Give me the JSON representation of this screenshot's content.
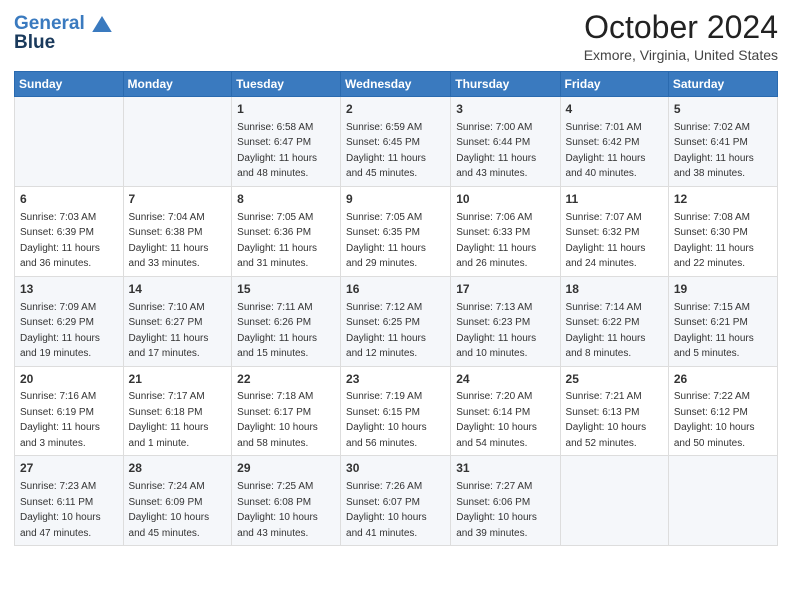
{
  "header": {
    "logo_line1": "General",
    "logo_line2": "Blue",
    "month_title": "October 2024",
    "location": "Exmore, Virginia, United States"
  },
  "days_of_week": [
    "Sunday",
    "Monday",
    "Tuesday",
    "Wednesday",
    "Thursday",
    "Friday",
    "Saturday"
  ],
  "weeks": [
    [
      null,
      null,
      {
        "day": "1",
        "sunrise": "6:58 AM",
        "sunset": "6:47 PM",
        "daylight": "11 hours and 48 minutes."
      },
      {
        "day": "2",
        "sunrise": "6:59 AM",
        "sunset": "6:45 PM",
        "daylight": "11 hours and 45 minutes."
      },
      {
        "day": "3",
        "sunrise": "7:00 AM",
        "sunset": "6:44 PM",
        "daylight": "11 hours and 43 minutes."
      },
      {
        "day": "4",
        "sunrise": "7:01 AM",
        "sunset": "6:42 PM",
        "daylight": "11 hours and 40 minutes."
      },
      {
        "day": "5",
        "sunrise": "7:02 AM",
        "sunset": "6:41 PM",
        "daylight": "11 hours and 38 minutes."
      }
    ],
    [
      {
        "day": "6",
        "sunrise": "7:03 AM",
        "sunset": "6:39 PM",
        "daylight": "11 hours and 36 minutes."
      },
      {
        "day": "7",
        "sunrise": "7:04 AM",
        "sunset": "6:38 PM",
        "daylight": "11 hours and 33 minutes."
      },
      {
        "day": "8",
        "sunrise": "7:05 AM",
        "sunset": "6:36 PM",
        "daylight": "11 hours and 31 minutes."
      },
      {
        "day": "9",
        "sunrise": "7:05 AM",
        "sunset": "6:35 PM",
        "daylight": "11 hours and 29 minutes."
      },
      {
        "day": "10",
        "sunrise": "7:06 AM",
        "sunset": "6:33 PM",
        "daylight": "11 hours and 26 minutes."
      },
      {
        "day": "11",
        "sunrise": "7:07 AM",
        "sunset": "6:32 PM",
        "daylight": "11 hours and 24 minutes."
      },
      {
        "day": "12",
        "sunrise": "7:08 AM",
        "sunset": "6:30 PM",
        "daylight": "11 hours and 22 minutes."
      }
    ],
    [
      {
        "day": "13",
        "sunrise": "7:09 AM",
        "sunset": "6:29 PM",
        "daylight": "11 hours and 19 minutes."
      },
      {
        "day": "14",
        "sunrise": "7:10 AM",
        "sunset": "6:27 PM",
        "daylight": "11 hours and 17 minutes."
      },
      {
        "day": "15",
        "sunrise": "7:11 AM",
        "sunset": "6:26 PM",
        "daylight": "11 hours and 15 minutes."
      },
      {
        "day": "16",
        "sunrise": "7:12 AM",
        "sunset": "6:25 PM",
        "daylight": "11 hours and 12 minutes."
      },
      {
        "day": "17",
        "sunrise": "7:13 AM",
        "sunset": "6:23 PM",
        "daylight": "11 hours and 10 minutes."
      },
      {
        "day": "18",
        "sunrise": "7:14 AM",
        "sunset": "6:22 PM",
        "daylight": "11 hours and 8 minutes."
      },
      {
        "day": "19",
        "sunrise": "7:15 AM",
        "sunset": "6:21 PM",
        "daylight": "11 hours and 5 minutes."
      }
    ],
    [
      {
        "day": "20",
        "sunrise": "7:16 AM",
        "sunset": "6:19 PM",
        "daylight": "11 hours and 3 minutes."
      },
      {
        "day": "21",
        "sunrise": "7:17 AM",
        "sunset": "6:18 PM",
        "daylight": "11 hours and 1 minute."
      },
      {
        "day": "22",
        "sunrise": "7:18 AM",
        "sunset": "6:17 PM",
        "daylight": "10 hours and 58 minutes."
      },
      {
        "day": "23",
        "sunrise": "7:19 AM",
        "sunset": "6:15 PM",
        "daylight": "10 hours and 56 minutes."
      },
      {
        "day": "24",
        "sunrise": "7:20 AM",
        "sunset": "6:14 PM",
        "daylight": "10 hours and 54 minutes."
      },
      {
        "day": "25",
        "sunrise": "7:21 AM",
        "sunset": "6:13 PM",
        "daylight": "10 hours and 52 minutes."
      },
      {
        "day": "26",
        "sunrise": "7:22 AM",
        "sunset": "6:12 PM",
        "daylight": "10 hours and 50 minutes."
      }
    ],
    [
      {
        "day": "27",
        "sunrise": "7:23 AM",
        "sunset": "6:11 PM",
        "daylight": "10 hours and 47 minutes."
      },
      {
        "day": "28",
        "sunrise": "7:24 AM",
        "sunset": "6:09 PM",
        "daylight": "10 hours and 45 minutes."
      },
      {
        "day": "29",
        "sunrise": "7:25 AM",
        "sunset": "6:08 PM",
        "daylight": "10 hours and 43 minutes."
      },
      {
        "day": "30",
        "sunrise": "7:26 AM",
        "sunset": "6:07 PM",
        "daylight": "10 hours and 41 minutes."
      },
      {
        "day": "31",
        "sunrise": "7:27 AM",
        "sunset": "6:06 PM",
        "daylight": "10 hours and 39 minutes."
      },
      null,
      null
    ]
  ],
  "labels": {
    "sunrise": "Sunrise:",
    "sunset": "Sunset:",
    "daylight": "Daylight:"
  }
}
